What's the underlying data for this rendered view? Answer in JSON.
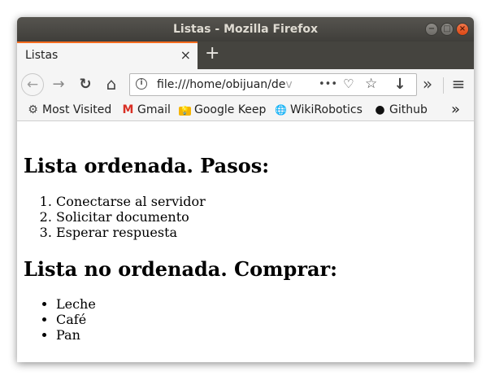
{
  "window": {
    "title": "Listas - Mozilla Firefox",
    "controls": {
      "minimize": "−",
      "maximize": "□",
      "close": "×"
    }
  },
  "tabs": [
    {
      "label": "Listas",
      "close": "×"
    }
  ],
  "new_tab": "+",
  "navbar": {
    "back": "←",
    "forward": "→",
    "reload": "↻",
    "home": "⌂",
    "url_info": "i",
    "url_start": "file:///home/obijuan/de",
    "url_fade": "v",
    "page_actions": "•••",
    "pocket": "♡",
    "bookmark_star": "☆",
    "downloads": "↓",
    "overflow": "»",
    "menu": "≡"
  },
  "bookmarks": {
    "items": [
      {
        "label": "Most Visited",
        "icon": "gear-icon",
        "glyph": "⚙"
      },
      {
        "label": "Gmail",
        "icon": "gmail-icon",
        "glyph": "M"
      },
      {
        "label": "Google Keep",
        "icon": "keep-icon",
        "glyph": "💡"
      },
      {
        "label": "WikiRobotics",
        "icon": "globe-icon",
        "glyph": "🌐"
      },
      {
        "label": "Github",
        "icon": "github-icon",
        "glyph": "●"
      }
    ],
    "overflow": "»"
  },
  "page": {
    "heading_ordered": "Lista ordenada. Pasos:",
    "ordered_items": [
      "Conectarse al servidor",
      "Solicitar documento",
      "Esperar respuesta"
    ],
    "heading_unordered": "Lista no ordenada. Comprar:",
    "unordered_items": [
      "Leche",
      "Café",
      "Pan"
    ]
  },
  "colors": {
    "accent_tab": "#ff6d1f",
    "gmail_red": "#d93025",
    "keep_yellow": "#f5b400"
  }
}
